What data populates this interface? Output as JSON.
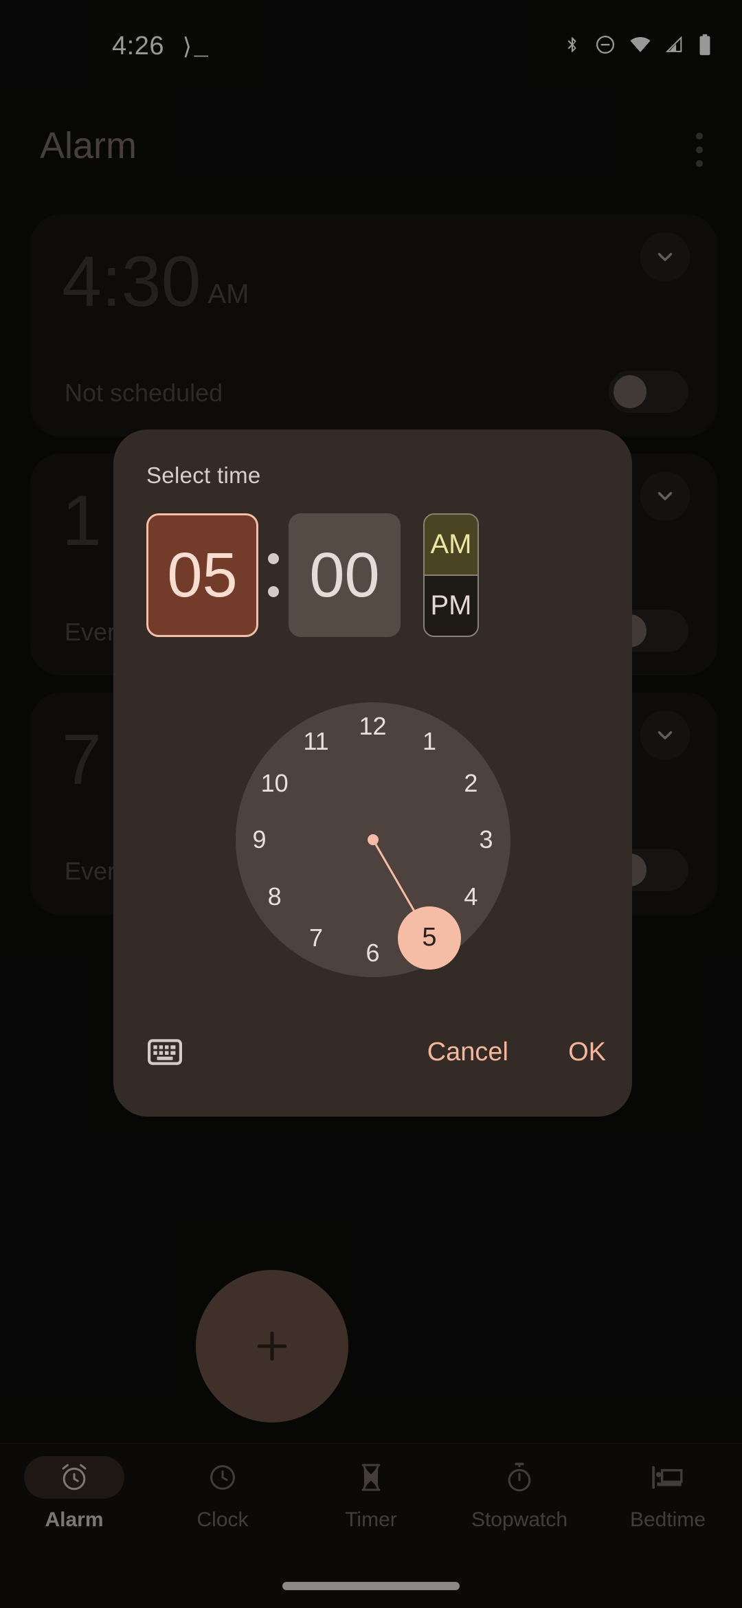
{
  "status_bar": {
    "time": "4:26",
    "prompt_icon": "terminal-prompt-icon",
    "icons": [
      "bluetooth-icon",
      "do-not-disturb-icon",
      "wifi-icon",
      "cellular-signal-icon",
      "battery-icon"
    ]
  },
  "app_bar": {
    "title": "Alarm",
    "overflow_icon": "more-vertical-icon"
  },
  "alarms": [
    {
      "time": "4:30",
      "ampm": "AM",
      "schedule": "Not scheduled",
      "enabled": false
    },
    {
      "time": "1",
      "ampm": "",
      "schedule": "Ever",
      "enabled": false
    },
    {
      "time": "7",
      "ampm": "",
      "schedule": "Ever",
      "enabled": false
    }
  ],
  "fab": {
    "icon": "plus-icon",
    "label": "+"
  },
  "bottom_nav": {
    "items": [
      {
        "label": "Alarm",
        "icon": "alarm-clock-icon",
        "active": true
      },
      {
        "label": "Clock",
        "icon": "clock-icon",
        "active": false
      },
      {
        "label": "Timer",
        "icon": "hourglass-icon",
        "active": false
      },
      {
        "label": "Stopwatch",
        "icon": "stopwatch-icon",
        "active": false
      },
      {
        "label": "Bedtime",
        "icon": "bed-icon",
        "active": false
      }
    ]
  },
  "dialog": {
    "title": "Select time",
    "hour": "05",
    "minute": "00",
    "colon": ":",
    "selected_field": "hour",
    "ampm": {
      "am_label": "AM",
      "pm_label": "PM",
      "selected": "AM"
    },
    "clock": {
      "mode": "hours",
      "numbers": [
        "12",
        "1",
        "2",
        "3",
        "4",
        "5",
        "6",
        "7",
        "8",
        "9",
        "10",
        "11"
      ],
      "selected_value": "5",
      "selected_index": 5
    },
    "keyboard_icon": "keyboard-icon",
    "cancel_label": "Cancel",
    "ok_label": "OK"
  },
  "colors": {
    "accent_salmon": "#f3b79d",
    "hour_field_bg": "#733c2a",
    "minute_field_bg": "#564a45",
    "am_selected_bg": "#4a4423",
    "dialog_bg": "#342b26",
    "clock_face_bg": "#4d423d",
    "fab_bg": "#6b5046",
    "page_bg": "#0d0c0b"
  }
}
